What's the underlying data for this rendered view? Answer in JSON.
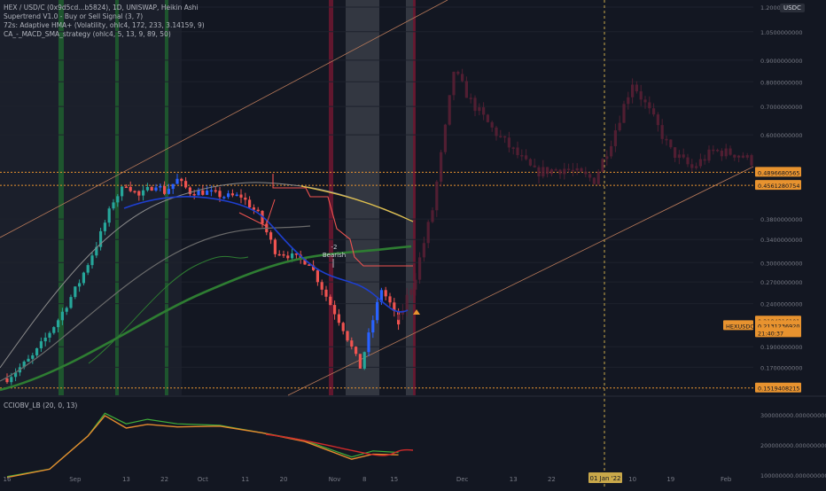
{
  "header": {
    "indicators": [
      "HEX / USD/C (0x9d5cd...b5824), 1D, UNISWAP, Heikin Ashi",
      "Supertrend V1.0 - Buy or Sell Signal (3, 7)",
      "72s: Adaptive HMA+ (Volatility, ohlc4, 172, 233, 3.14159, 9)",
      "CA_-_MACD_SMA_strategy (ohlc4, 5, 13, 9, 89, 50)"
    ],
    "currency_badge": "USDC"
  },
  "oscillator": {
    "title": "CCIOBV_LB (20, 0, 13)",
    "axis_labels": [
      "300000000.0000000000",
      "200000000.0000000000",
      "100000000.0000000000"
    ]
  },
  "annotations": {
    "signal_value": "-2",
    "signal_label": "Bearish"
  },
  "price_badges": [
    {
      "text": "0.4896680565",
      "value": 0.4896680565
    },
    {
      "text": "0.4561280754",
      "value": 0.4561280754
    },
    {
      "text": "0.2184316101",
      "value": 0.2184316101
    },
    {
      "text": "0.2131236920",
      "value": 0.213123692
    },
    {
      "text": "21:40:37",
      "value": 0.205
    },
    {
      "text": "0.1519408215",
      "value": 0.1519408215
    }
  ],
  "symbol_badge": "HEXUSDC",
  "crosshair_date": "01 Jan '22",
  "colors": {
    "background": "#131722",
    "bull": "#26a69a",
    "bear": "#ef5350",
    "hma": "#1e3fcf",
    "badge": "#e8932f",
    "projection": "#5c2035"
  },
  "chart_data": {
    "type": "candlestick",
    "scale": "log",
    "ylim": [
      0.146,
      1.2
    ],
    "y_ticks": [
      {
        "label": "1.2000000000",
        "value": 1.2
      },
      {
        "label": "1.0500000000",
        "value": 1.05
      },
      {
        "label": "0.9000000000",
        "value": 0.9
      },
      {
        "label": "0.8000000000",
        "value": 0.8
      },
      {
        "label": "0.7000000000",
        "value": 0.7
      },
      {
        "label": "0.6000000000",
        "value": 0.6
      },
      {
        "label": "0.3800000000",
        "value": 0.38
      },
      {
        "label": "0.3400000000",
        "value": 0.34
      },
      {
        "label": "0.3000000000",
        "value": 0.3
      },
      {
        "label": "0.2700000000",
        "value": 0.27
      },
      {
        "label": "0.2400000000",
        "value": 0.24
      },
      {
        "label": "0.1900000000",
        "value": 0.19
      },
      {
        "label": "0.1700000000",
        "value": 0.17
      }
    ],
    "x_ticks": [
      {
        "label": "16",
        "date": "2021-08-16"
      },
      {
        "label": "Sep",
        "date": "2021-09-01"
      },
      {
        "label": "13",
        "date": "2021-09-13"
      },
      {
        "label": "22",
        "date": "2021-09-22"
      },
      {
        "label": "Oct",
        "date": "2021-10-01"
      },
      {
        "label": "11",
        "date": "2021-10-11"
      },
      {
        "label": "20",
        "date": "2021-10-20"
      },
      {
        "label": "Nov",
        "date": "2021-11-01"
      },
      {
        "label": "8",
        "date": "2021-11-08"
      },
      {
        "label": "15",
        "date": "2021-11-15"
      },
      {
        "label": "Dec",
        "date": "2021-12-01"
      },
      {
        "label": "13",
        "date": "2021-12-13"
      },
      {
        "label": "22",
        "date": "2021-12-22"
      },
      {
        "label": "10",
        "date": "2022-01-10"
      },
      {
        "label": "19",
        "date": "2022-01-19"
      },
      {
        "label": "Feb",
        "date": "2022-02-01"
      }
    ],
    "series": [
      {
        "name": "HEX / USD/C",
        "points": [
          {
            "date": "2021-08-16",
            "close": 0.16
          },
          {
            "date": "2021-08-22",
            "close": 0.18
          },
          {
            "date": "2021-08-28",
            "close": 0.22
          },
          {
            "date": "2021-09-02",
            "close": 0.27
          },
          {
            "date": "2021-09-06",
            "close": 0.33
          },
          {
            "date": "2021-09-10",
            "close": 0.42
          },
          {
            "date": "2021-09-13",
            "close": 0.46
          },
          {
            "date": "2021-09-16",
            "close": 0.43
          },
          {
            "date": "2021-09-20",
            "close": 0.46
          },
          {
            "date": "2021-09-22",
            "close": 0.44
          },
          {
            "date": "2021-09-25",
            "close": 0.47
          },
          {
            "date": "2021-09-28",
            "close": 0.44
          },
          {
            "date": "2021-10-02",
            "close": 0.44
          },
          {
            "date": "2021-10-06",
            "close": 0.43
          },
          {
            "date": "2021-10-10",
            "close": 0.43
          },
          {
            "date": "2021-10-14",
            "close": 0.39
          },
          {
            "date": "2021-10-18",
            "close": 0.32
          },
          {
            "date": "2021-10-22",
            "close": 0.31
          },
          {
            "date": "2021-10-26",
            "close": 0.3
          },
          {
            "date": "2021-10-30",
            "close": 0.25
          },
          {
            "date": "2021-11-03",
            "close": 0.21
          },
          {
            "date": "2021-11-07",
            "close": 0.17
          },
          {
            "date": "2021-11-10",
            "close": 0.22
          },
          {
            "date": "2021-11-12",
            "close": 0.26
          },
          {
            "date": "2021-11-14",
            "close": 0.24
          },
          {
            "date": "2021-11-16",
            "close": 0.215
          }
        ]
      },
      {
        "name": "projection",
        "points": [
          {
            "date": "2021-11-16",
            "close": 0.22
          },
          {
            "date": "2021-11-20",
            "close": 0.28
          },
          {
            "date": "2021-11-24",
            "close": 0.4
          },
          {
            "date": "2021-11-27",
            "close": 0.62
          },
          {
            "date": "2021-11-29",
            "close": 0.85
          },
          {
            "date": "2021-12-03",
            "close": 0.72
          },
          {
            "date": "2021-12-08",
            "close": 0.62
          },
          {
            "date": "2021-12-13",
            "close": 0.55
          },
          {
            "date": "2021-12-18",
            "close": 0.49
          },
          {
            "date": "2021-12-25",
            "close": 0.5
          },
          {
            "date": "2022-01-01",
            "close": 0.47
          },
          {
            "date": "2022-01-05",
            "close": 0.58
          },
          {
            "date": "2022-01-10",
            "close": 0.8
          },
          {
            "date": "2022-01-14",
            "close": 0.68
          },
          {
            "date": "2022-01-19",
            "close": 0.55
          },
          {
            "date": "2022-01-24",
            "close": 0.5
          },
          {
            "date": "2022-01-29",
            "close": 0.55
          },
          {
            "date": "2022-02-04",
            "close": 0.54
          },
          {
            "date": "2022-02-07",
            "close": 0.52
          }
        ]
      },
      {
        "name": "CCIOBV",
        "points": [
          {
            "date": "2021-08-16",
            "value": 95000000
          },
          {
            "date": "2021-08-26",
            "value": 120000000
          },
          {
            "date": "2021-09-04",
            "value": 230000000
          },
          {
            "date": "2021-09-08",
            "value": 305000000
          },
          {
            "date": "2021-09-13",
            "value": 270000000
          },
          {
            "date": "2021-09-18",
            "value": 285000000
          },
          {
            "date": "2021-09-25",
            "value": 270000000
          },
          {
            "date": "2021-10-05",
            "value": 265000000
          },
          {
            "date": "2021-10-15",
            "value": 240000000
          },
          {
            "date": "2021-10-25",
            "value": 215000000
          },
          {
            "date": "2021-11-05",
            "value": 160000000
          },
          {
            "date": "2021-11-10",
            "value": 180000000
          },
          {
            "date": "2021-11-16",
            "value": 175000000
          }
        ]
      }
    ]
  }
}
